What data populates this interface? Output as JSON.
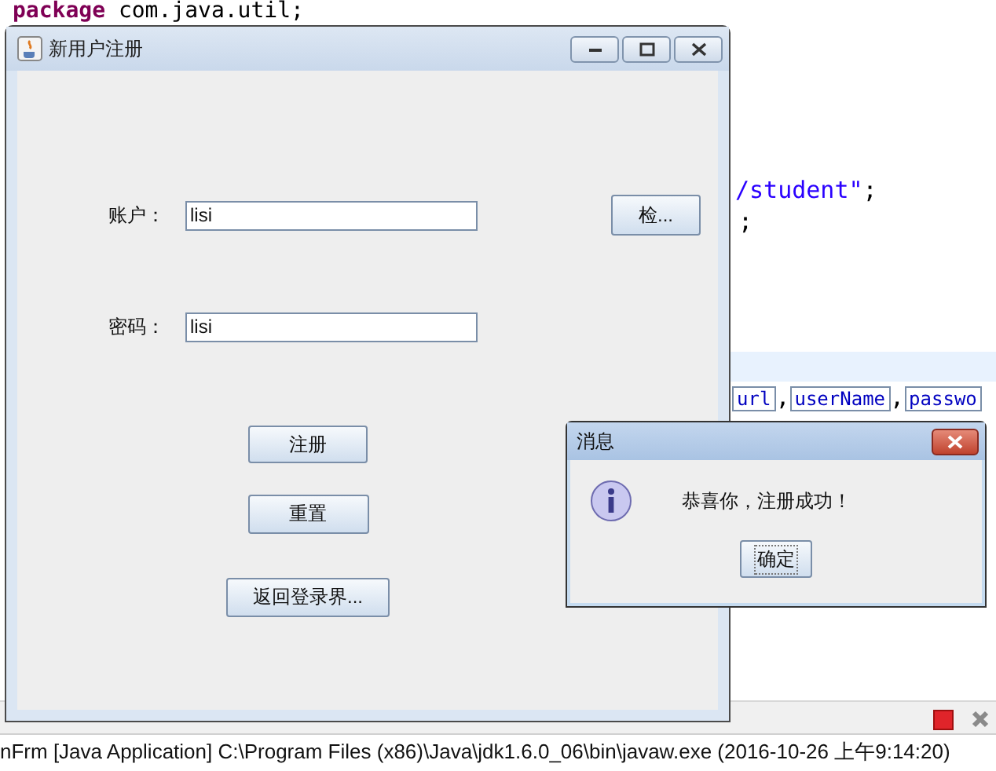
{
  "editor": {
    "lines": [
      {
        "segments": [
          {
            "text": "package",
            "kind": "keyword"
          },
          {
            "text": " com.java.util;",
            "kind": "plain"
          }
        ]
      },
      {
        "segments": [
          {
            "text": "/student\"",
            "kind": "string"
          },
          {
            "text": ";",
            "kind": "plain"
          }
        ]
      },
      {
        "segments": [
          {
            "text": ";",
            "kind": "plain"
          }
        ]
      },
      {
        "segments": [
          {
            "text": "url",
            "kind": "field"
          },
          {
            "text": ",",
            "kind": "plain"
          },
          {
            "text": "userName",
            "kind": "field"
          },
          {
            "text": ",",
            "kind": "plain"
          },
          {
            "text": "passwo",
            "kind": "field"
          }
        ]
      }
    ]
  },
  "console": {
    "text": "nFrm [Java Application] C:\\Program Files (x86)\\Java\\jdk1.6.0_06\\bin\\javaw.exe (2016-10-26 上午9:14:20)"
  },
  "window": {
    "title": "新用户注册",
    "fields": [
      {
        "label": "账户：",
        "value": "lisi"
      },
      {
        "label": "密码：",
        "value": "lisi"
      }
    ],
    "check_button": "检...",
    "buttons": [
      "注册",
      "重置",
      "返回登录界..."
    ]
  },
  "dialog": {
    "title": "消息",
    "message": "恭喜你，注册成功！",
    "button": "确定"
  }
}
